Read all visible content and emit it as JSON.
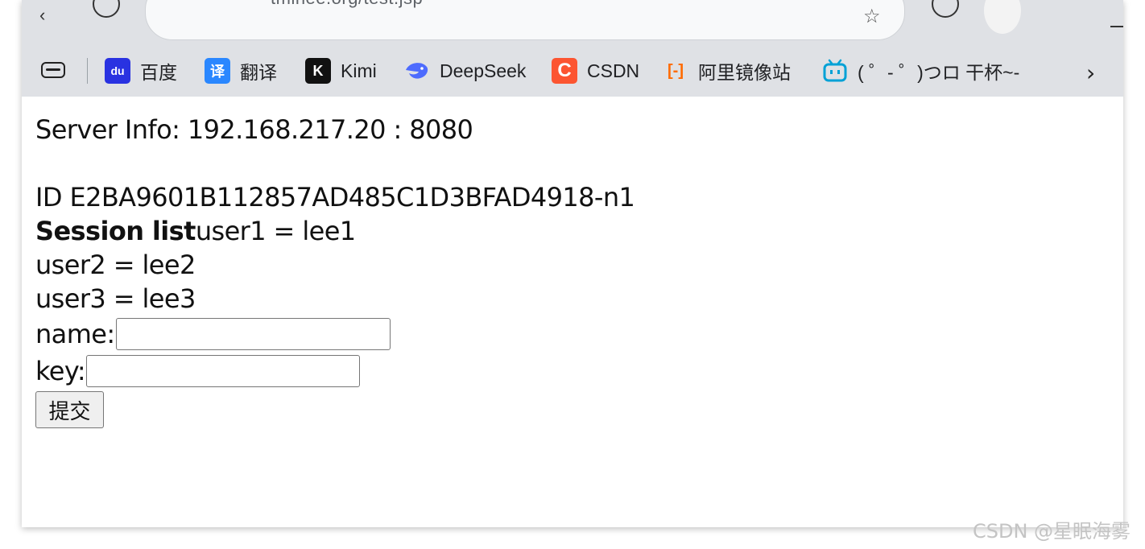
{
  "browser": {
    "url": "tminee.org/test.jsp",
    "bookmarks": [
      {
        "label": "百度",
        "icon": "baidu-icon",
        "icon_text": "du",
        "color": "#2932e1"
      },
      {
        "label": "翻译",
        "icon": "translate-icon",
        "icon_text": "译",
        "color": "#2a87ff"
      },
      {
        "label": "Kimi",
        "icon": "kimi-icon",
        "icon_text": "K",
        "color": "#111111"
      },
      {
        "label": "DeepSeek",
        "icon": "deepseek-icon",
        "icon_text": "🐋",
        "color": "#4d6bfe"
      },
      {
        "label": "CSDN",
        "icon": "csdn-icon",
        "icon_text": "C",
        "color": "#fc5531"
      },
      {
        "label": "阿里镜像站",
        "icon": "aliyun-icon",
        "icon_text": "[-]",
        "color": "#ff6a00"
      },
      {
        "label": "( ゜- ゜)つロ 干杯~-",
        "icon": "bilibili-icon",
        "icon_text": "▪▪",
        "color": "#00a1d6"
      }
    ]
  },
  "page": {
    "server_info": "Server Info: 192.168.217.20 : 8080",
    "session_id": "ID E2BA9601B112857AD485C1D3BFAD4918-n1",
    "session_list_label": "Session list",
    "session_entries": [
      "user1 = lee1",
      "user2 = lee2",
      "user3 = lee3"
    ],
    "form": {
      "name_label": "name:",
      "name_value": "",
      "key_label": "key:",
      "key_value": "",
      "submit_label": "提交"
    }
  },
  "watermark": "CSDN @星眠海雾"
}
